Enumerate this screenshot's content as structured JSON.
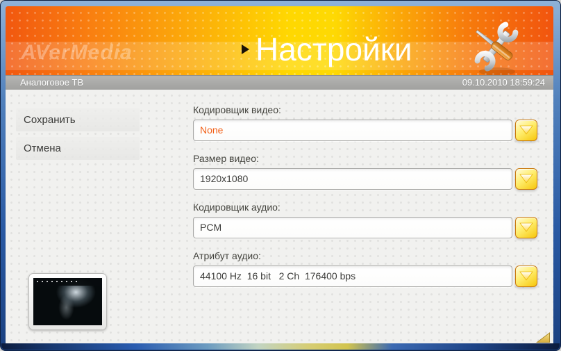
{
  "window": {
    "brand": "AVerMedia",
    "title": "Настройки",
    "mode_label": "Аналоговое ТВ",
    "datetime": "09.10.2010 18:59:24"
  },
  "sidebar": {
    "save_label": "Сохранить",
    "cancel_label": "Отмена"
  },
  "form": {
    "fields": [
      {
        "label": "Кодировщик видео:",
        "value": "None"
      },
      {
        "label": "Размер видео:",
        "value": "1920x1080"
      },
      {
        "label": "Кодировщик аудио:",
        "value": "PCM"
      },
      {
        "label": "Атрибут аудио:",
        "value": "44100 Hz  16 bit   2 Ch  176400 bps"
      }
    ]
  },
  "icons": {
    "header_tools": "wrench-screwdriver-icon",
    "title_marker": "right-arrow-icon",
    "dropdown": "dropdown-arrow-icon",
    "resize": "resize-grip-icon"
  },
  "colors": {
    "accent_value": "#f26018",
    "header_orange": "#f1570f",
    "header_yellow": "#ffd801",
    "dropdown_yellow": "#f6c60a",
    "border_blue": "#2a5aa4"
  }
}
